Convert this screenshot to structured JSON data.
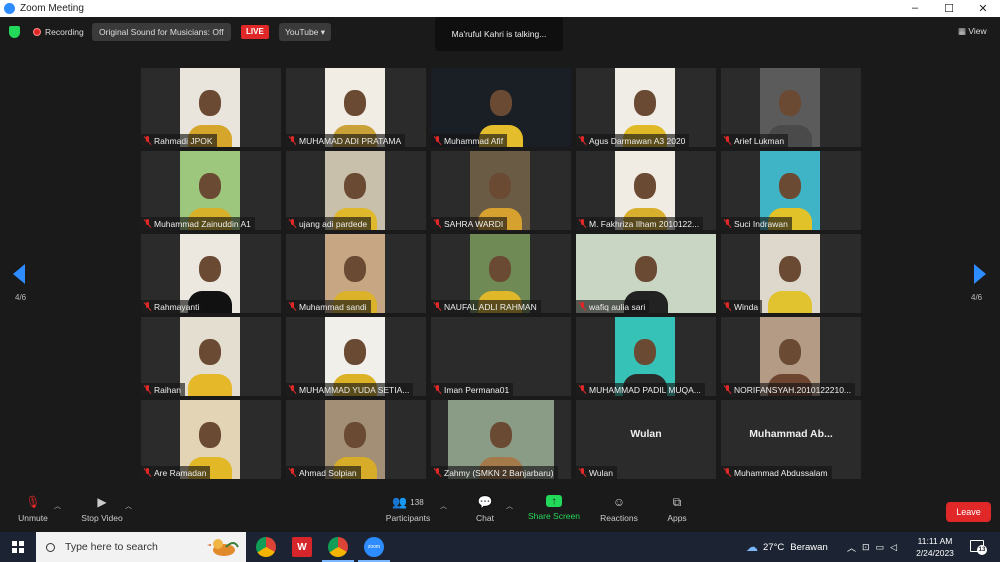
{
  "window": {
    "title": "Zoom Meeting",
    "controls": [
      "–",
      "☐",
      "✕"
    ]
  },
  "topbar": {
    "recording_label": "Recording",
    "original_sound_label": "Original Sound for Musicians: Off",
    "live_label": "LIVE",
    "stream_label": "YouTube ▾",
    "talking_label": "Ma'ruful Kahri is talking...",
    "view_label": "View"
  },
  "pager": {
    "left": "4/6",
    "right": "4/6"
  },
  "participants": [
    {
      "name": "Rahmadi JPOK",
      "video": "narrow",
      "bg": "#e9e5dc",
      "shirt": "#d6a52b"
    },
    {
      "name": "MUHAMAD ADI PRATAMA",
      "video": "narrow",
      "bg": "#f2ede4",
      "shirt": "#c9a136"
    },
    {
      "name": "Muhammad Afif",
      "video": "wide",
      "bg": "#1a1f26",
      "shirt": "#e3bd2c"
    },
    {
      "name": "Agus Darmawan A3 2020",
      "video": "narrow",
      "bg": "#f0ede6",
      "shirt": "#e0ba26"
    },
    {
      "name": "Arief Lukman",
      "video": "narrow",
      "bg": "#5b5b5b",
      "shirt": "#4a4a4a"
    },
    {
      "name": "Muhammad Zainuddin A1",
      "video": "narrow",
      "bg": "#9dc77c",
      "shirt": "#d8b12a"
    },
    {
      "name": "ujang adi pardede",
      "video": "narrow",
      "bg": "#c8c0aa",
      "shirt": "#e0b82c"
    },
    {
      "name": "SAHRA WARDI",
      "video": "narrow",
      "bg": "#6a5b45",
      "shirt": "#d6a12f"
    },
    {
      "name": "M. Fakhriza Ilham 2010122...",
      "video": "narrow",
      "bg": "#f0ece3",
      "shirt": "#d9b02e"
    },
    {
      "name": "Suci Indrawan",
      "video": "narrow",
      "bg": "#3fb4c6",
      "shirt": "#e2c229"
    },
    {
      "name": "Rahmayanti",
      "video": "narrow",
      "bg": "#ece8e0",
      "shirt": "#111111"
    },
    {
      "name": "Muhammad sandi",
      "video": "narrow",
      "bg": "#c7a684",
      "shirt": "#dcb22b"
    },
    {
      "name": "NAUFAL ADLI RAHMAN",
      "video": "narrow",
      "bg": "#6f8a55",
      "shirt": "#dfb728"
    },
    {
      "name": "wafiq aulia sari",
      "video": "wide",
      "bg": "#c9d6c3",
      "shirt": "#222222"
    },
    {
      "name": "Winda",
      "video": "narrow",
      "bg": "#ded8cc",
      "shirt": "#e1c32f"
    },
    {
      "name": "Raihan",
      "video": "narrow",
      "bg": "#e4ded1",
      "shirt": "#e5b82a"
    },
    {
      "name": "MUHAMMAD YUDA SETIA...",
      "video": "narrow",
      "bg": "#f1efe9",
      "shirt": "#dcb126"
    },
    {
      "name": "Iman Permana01",
      "video": "none"
    },
    {
      "name": "MUHAMMAD PADIL MUQA...",
      "video": "narrow",
      "bg": "#37c2b7",
      "shirt": "#2a2a2a"
    },
    {
      "name": "NORIFANSYAH.2010122210...",
      "video": "narrow",
      "bg": "#b39b86",
      "shirt": "#6d4530"
    },
    {
      "name": "Are Ramadan",
      "video": "narrow",
      "bg": "#e3d4b5",
      "shirt": "#e2b826"
    },
    {
      "name": "Ahmad Solpian",
      "video": "narrow",
      "bg": "#a38f76",
      "shirt": "#d7ac28"
    },
    {
      "name": "Zahmy (SMKN 2 Banjarbaru)",
      "video": "mid",
      "bg": "#8a9c86",
      "shirt": "#a57a4a"
    },
    {
      "name": "Wulan",
      "video": "none",
      "display": "Wulan"
    },
    {
      "name": "Muhammad Abdussalam",
      "video": "none",
      "display": "Muhammad  Ab..."
    }
  ],
  "toolbar": {
    "unmute": "Unmute",
    "stop_video": "Stop Video",
    "participants_count": "138",
    "participants": "Participants",
    "chat": "Chat",
    "share_screen": "Share Screen",
    "reactions": "Reactions",
    "apps": "Apps",
    "leave": "Leave"
  },
  "taskbar": {
    "search_placeholder": "Type here to search",
    "weather_temp": "27°C",
    "weather_desc": "Berawan",
    "time": "11:11 AM",
    "date": "2/24/2023",
    "notification_count": "13"
  },
  "colors": {
    "accent": "#2d8cff",
    "danger": "#e02828",
    "share": "#23d959"
  }
}
